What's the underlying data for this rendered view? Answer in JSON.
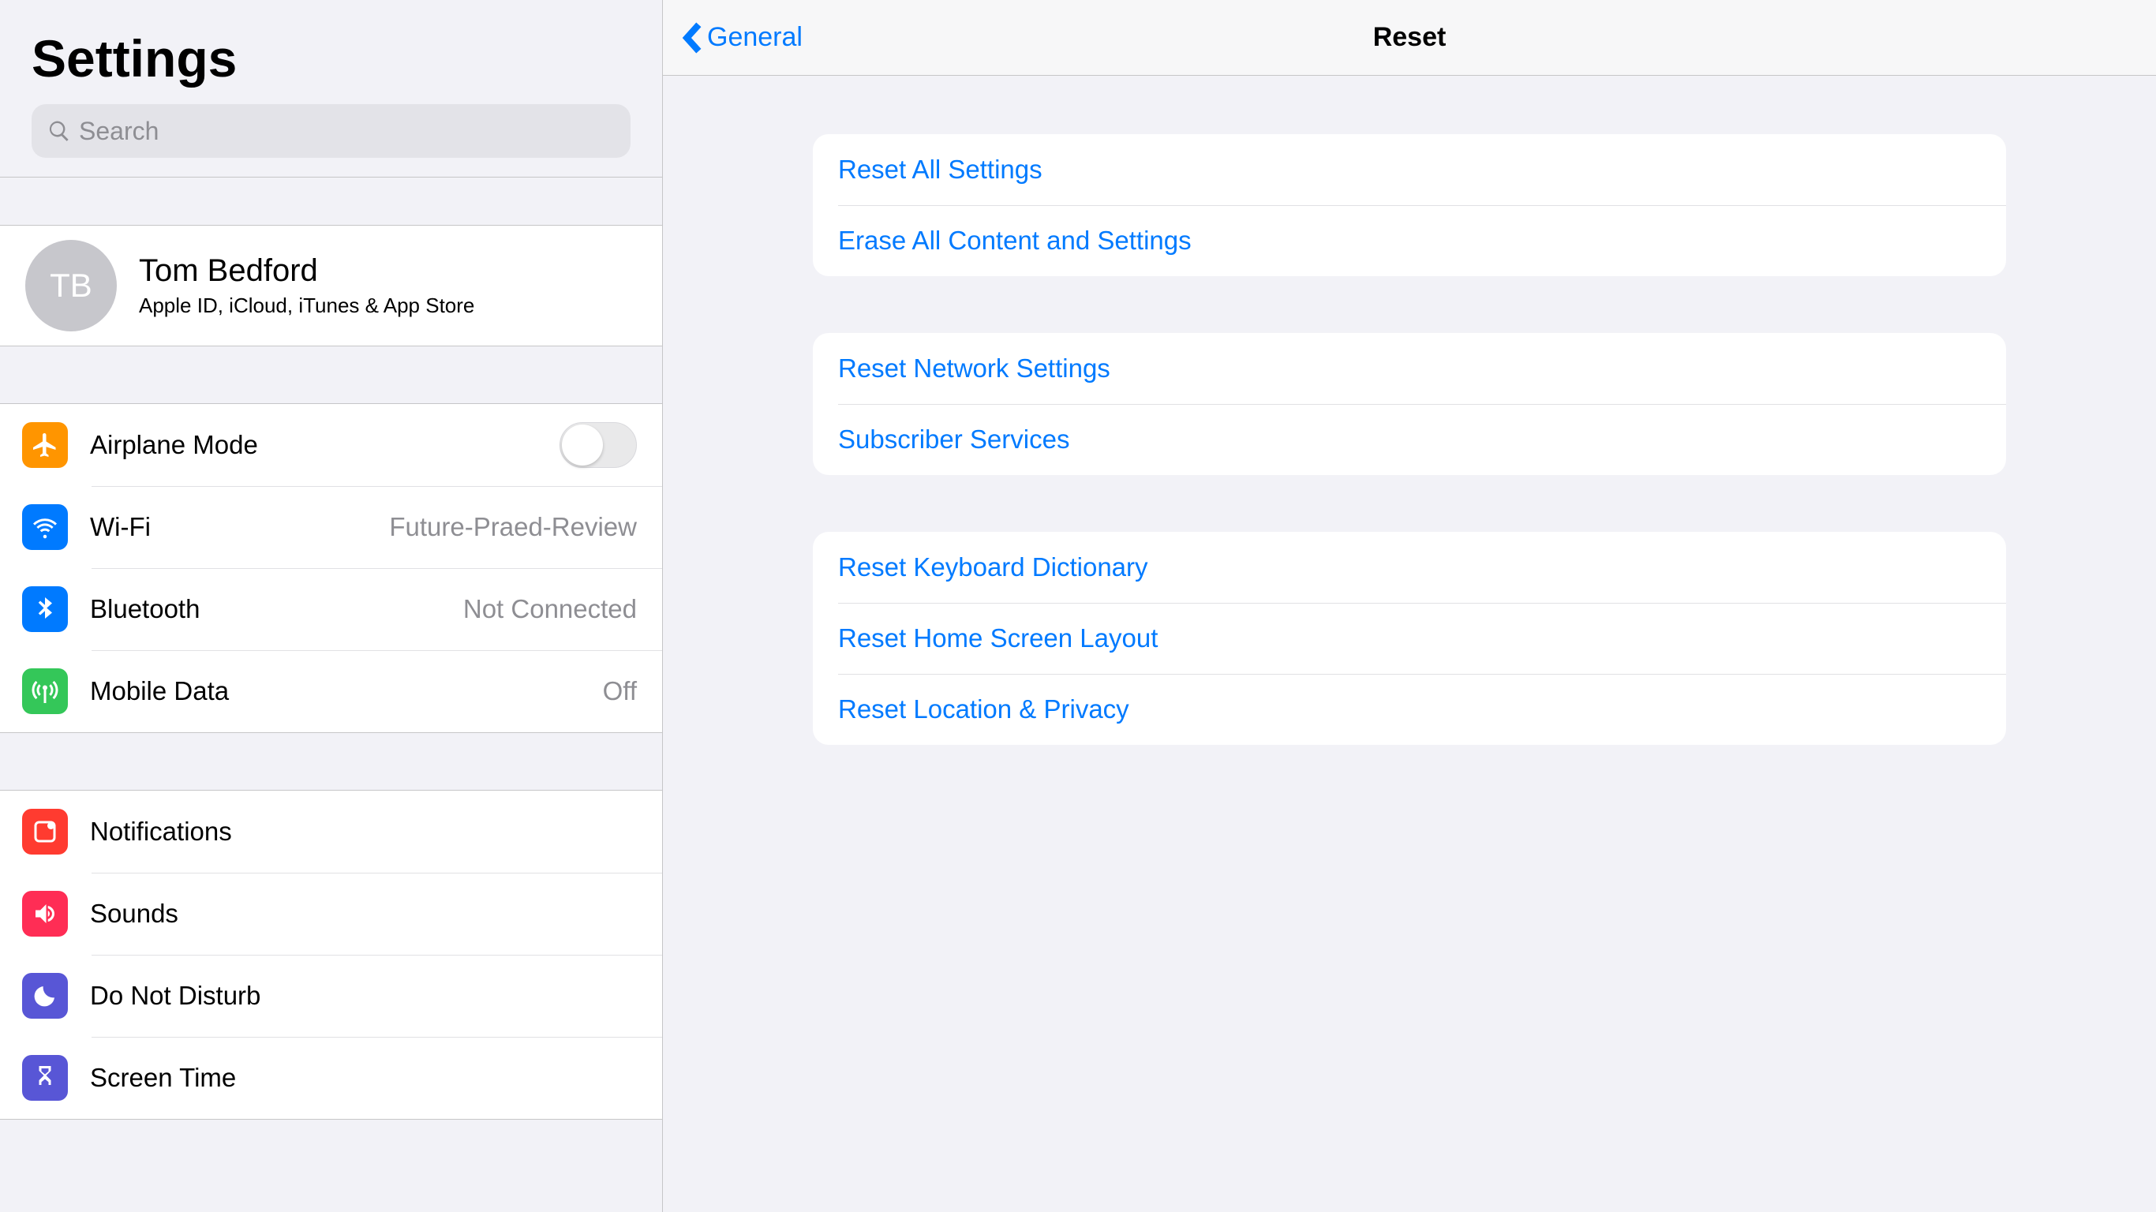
{
  "sidebar": {
    "title": "Settings",
    "search_placeholder": "Search",
    "account": {
      "initials": "TB",
      "name": "Tom Bedford",
      "subtitle": "Apple ID, iCloud, iTunes & App Store"
    },
    "network_group": {
      "airplane": {
        "label": "Airplane Mode"
      },
      "wifi": {
        "label": "Wi-Fi",
        "value": "Future-Praed-Review"
      },
      "bluetooth": {
        "label": "Bluetooth",
        "value": "Not Connected"
      },
      "mobile_data": {
        "label": "Mobile Data",
        "value": "Off"
      }
    },
    "misc_group": {
      "notifications": {
        "label": "Notifications"
      },
      "sounds": {
        "label": "Sounds"
      },
      "dnd": {
        "label": "Do Not Disturb"
      },
      "screen_time": {
        "label": "Screen Time"
      }
    }
  },
  "main": {
    "back_label": "General",
    "title": "Reset",
    "sections": {
      "s1": {
        "reset_all": "Reset All Settings",
        "erase_all": "Erase All Content and Settings"
      },
      "s2": {
        "reset_network": "Reset Network Settings",
        "subscriber": "Subscriber Services"
      },
      "s3": {
        "reset_keyboard": "Reset Keyboard Dictionary",
        "reset_home": "Reset Home Screen Layout",
        "reset_location": "Reset Location & Privacy"
      }
    }
  }
}
